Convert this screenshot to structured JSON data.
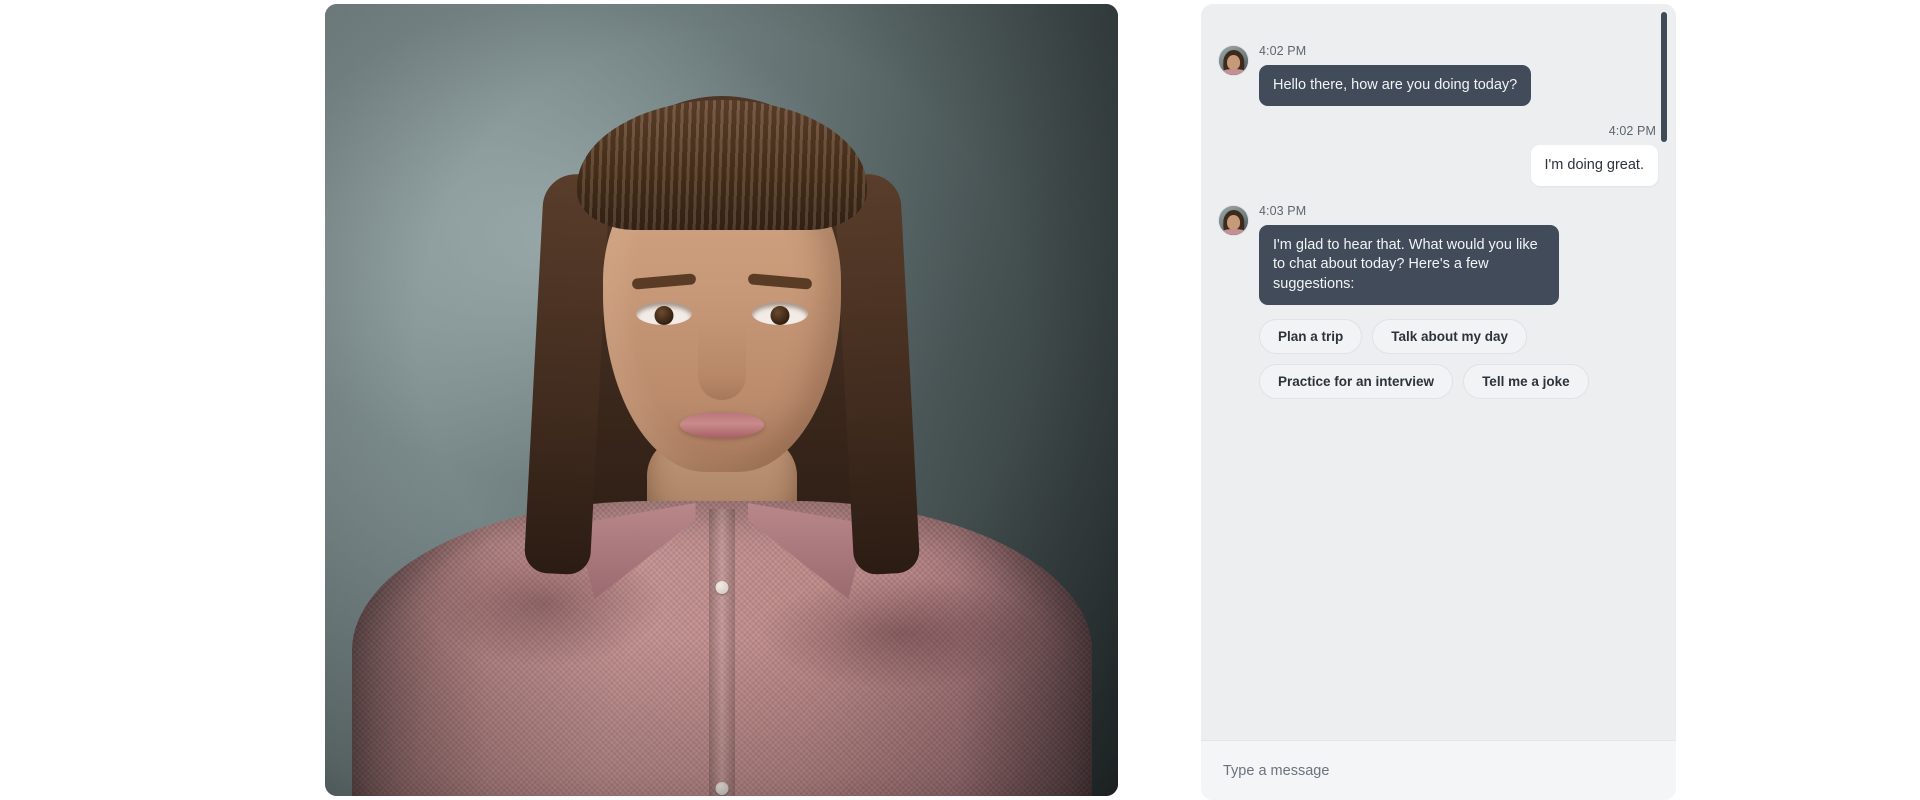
{
  "video": {
    "label": "avatar-video-stream",
    "subject": "woman in mauve button-up shirt",
    "background_color": "#5f6d6d",
    "shirt_color": "#bb8786"
  },
  "chat": {
    "panel_background": "#eceef0",
    "bot_bubble_color": "#414b59",
    "user_bubble_color": "#ffffff",
    "scrollbar_color": "#3f4a59",
    "messages": [
      {
        "sender": "bot",
        "time": "4:02 PM",
        "text": "Hello there, how are you doing today?",
        "has_avatar": true
      },
      {
        "sender": "user",
        "time": "4:02 PM",
        "text": "I'm doing great.",
        "has_avatar": false
      },
      {
        "sender": "bot",
        "time": "4:03 PM",
        "text": "I'm glad to hear that. What would you like to chat about today? Here's a few suggestions:",
        "has_avatar": true
      }
    ],
    "suggestions": [
      "Plan a trip",
      "Talk about my day",
      "Practice for an interview",
      "Tell me a joke"
    ],
    "composer": {
      "placeholder": "Type a message",
      "value": ""
    }
  }
}
